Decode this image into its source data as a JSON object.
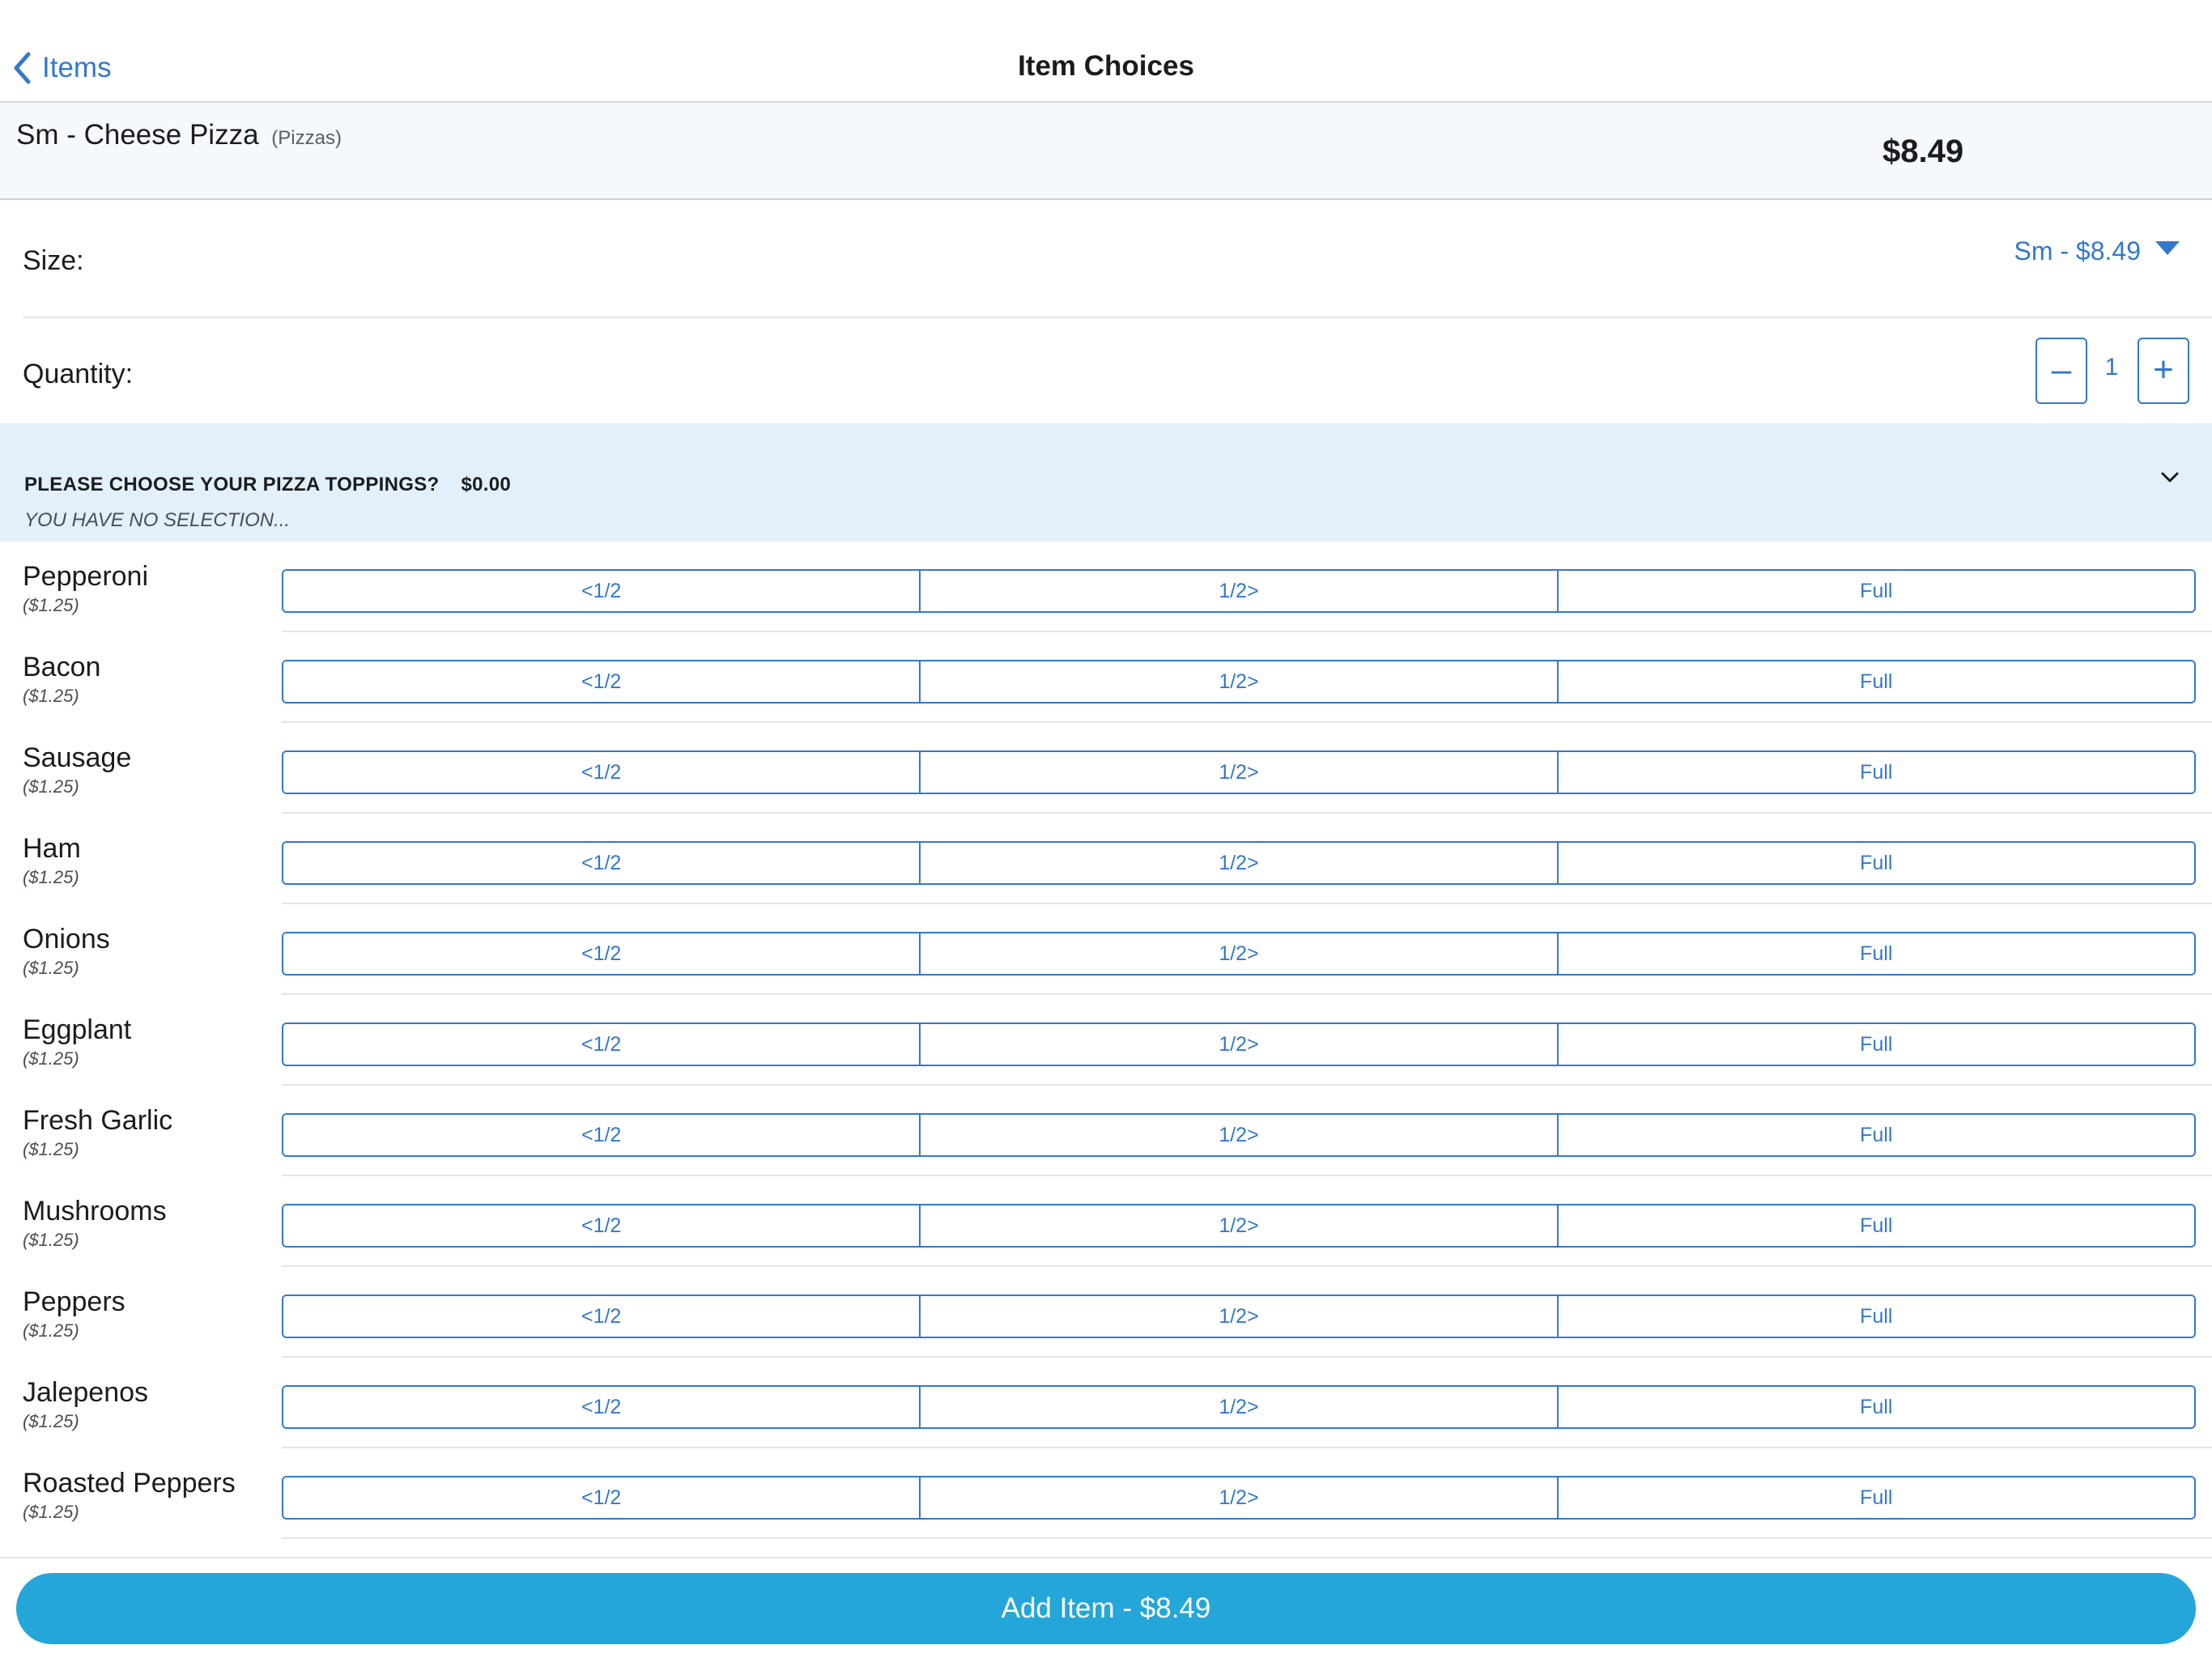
{
  "nav": {
    "back_label": "Items",
    "title": "Item Choices"
  },
  "item": {
    "name": "Sm - Cheese Pizza",
    "category": "(Pizzas)",
    "price": "$8.49"
  },
  "size": {
    "label": "Size:",
    "selected": "Sm - $8.49"
  },
  "quantity": {
    "label": "Quantity:",
    "value": "1",
    "minus": "–",
    "plus": "+"
  },
  "toppings_group": {
    "title": "PLEASE CHOOSE YOUR PIZZA TOPPINGS?",
    "price": "$0.00",
    "subtitle": "YOU HAVE NO SELECTION..."
  },
  "portion_options": [
    "<1/2",
    "1/2>",
    "Full"
  ],
  "toppings": [
    {
      "name": "Pepperoni",
      "price": "($1.25)"
    },
    {
      "name": "Bacon",
      "price": "($1.25)"
    },
    {
      "name": "Sausage",
      "price": "($1.25)"
    },
    {
      "name": "Ham",
      "price": "($1.25)"
    },
    {
      "name": "Onions",
      "price": "($1.25)"
    },
    {
      "name": "Eggplant",
      "price": "($1.25)"
    },
    {
      "name": "Fresh Garlic",
      "price": "($1.25)"
    },
    {
      "name": "Mushrooms",
      "price": "($1.25)"
    },
    {
      "name": "Peppers",
      "price": "($1.25)"
    },
    {
      "name": "Jalepenos",
      "price": "($1.25)"
    },
    {
      "name": "Roasted Peppers",
      "price": "($1.25)"
    }
  ],
  "footer": {
    "add_button": "Add Item - $8.49"
  },
  "colors": {
    "accent": "#3478c9",
    "add_button": "#25a6d9",
    "group_header_bg": "#e2f0fc",
    "item_header_bg": "#f5f9fc"
  },
  "icons": {
    "back": "chevron-left-icon",
    "size_dropdown": "caret-down-icon",
    "group_expand": "chevron-down-icon"
  }
}
